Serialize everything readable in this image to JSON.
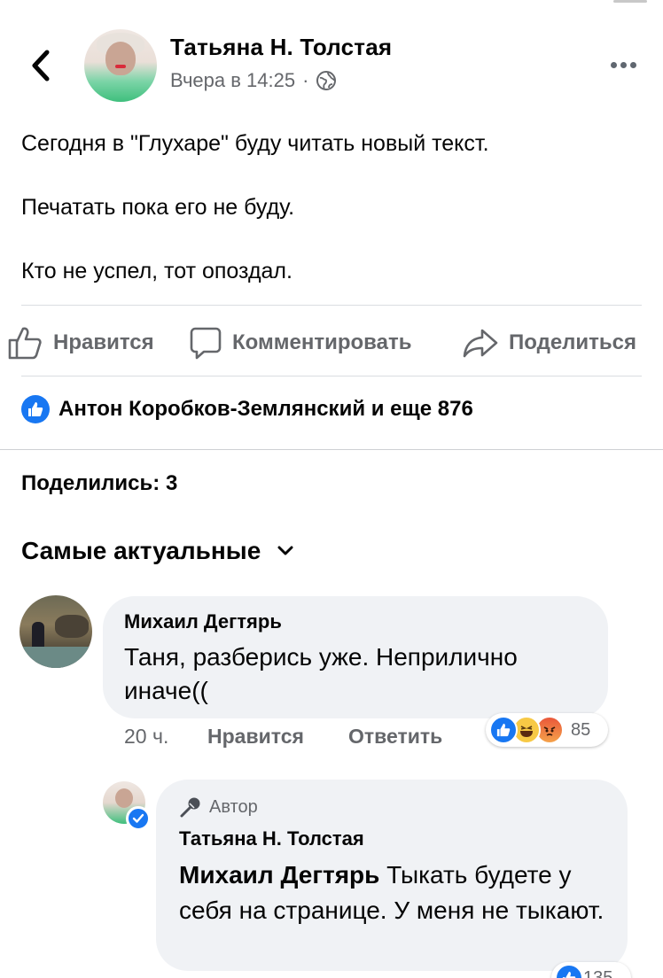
{
  "post": {
    "author": "Татьяна Н. Толстая",
    "timestamp": "Вчера в 14:25",
    "separator": "·",
    "privacy_icon": "globe-icon",
    "paragraphs": [
      "Сегодня в \"Глухаре\" буду читать новый текст.",
      "Печатать пока его не буду.",
      "Кто не успел, тот опоздал."
    ]
  },
  "actions": {
    "like": "Нравится",
    "comment": "Комментировать",
    "share": "Поделиться"
  },
  "reactions_summary": "Антон Коробков-Землянский и еще 876",
  "shares": "Поделились: 3",
  "sort_label": "Самые актуальные",
  "comments": [
    {
      "author": "Михаил Дегтярь",
      "text": "Таня, разберись уже. Неприлично иначе((",
      "time": "20 ч.",
      "like": "Нравится",
      "reply": "Ответить",
      "reaction_count": "85",
      "reactions": [
        "like-icon",
        "haha-icon",
        "angry-icon"
      ]
    },
    {
      "badge": "Автор",
      "author": "Татьяна Н. Толстая",
      "mention": "Михаил Дегтярь",
      "text": " Тыкать будете у себя на странице. У меня не тыкают.",
      "reaction_count": "135"
    }
  ],
  "colors": {
    "accent": "#1877f2",
    "secondary_text": "#65676b",
    "bubble": "#f0f2f5"
  }
}
